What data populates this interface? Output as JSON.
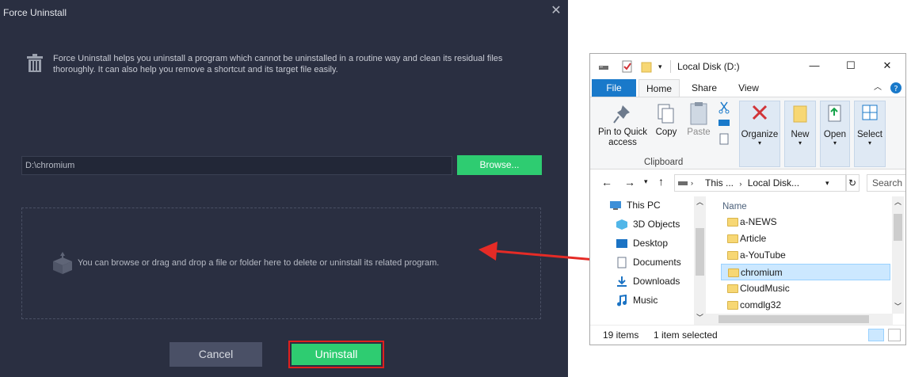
{
  "dialog": {
    "title": "Force Uninstall",
    "close_glyph": "✕",
    "description": "Force Uninstall helps you uninstall a program which cannot be uninstalled in a routine way and clean its residual files thoroughly. It can also help you remove a shortcut and its target file easily.",
    "path_value": "D:\\chromium",
    "browse_label": "Browse...",
    "drop_text": "You can browse or drag and drop a file or folder here to delete or uninstall its related program.",
    "cancel_label": "Cancel",
    "uninstall_label": "Uninstall",
    "colors": {
      "background": "#2a2f41",
      "accent_green": "#2ecc71",
      "highlight_red": "#e0201e"
    }
  },
  "explorer": {
    "title": "Local Disk (D:)",
    "tabs": [
      "File",
      "Home",
      "Share",
      "View"
    ],
    "ribbon": {
      "pin_label": "Pin to Quick access",
      "copy_label": "Copy",
      "paste_label": "Paste",
      "clipboard_label": "Clipboard",
      "organize_label": "Organize",
      "new_label": "New",
      "open_label": "Open",
      "select_label": "Select"
    },
    "address": {
      "this_pc": "This ...",
      "local_disk": "Local Disk...",
      "search_placeholder": "Search L"
    },
    "nav_items": [
      "This PC",
      "3D Objects",
      "Desktop",
      "Documents",
      "Downloads",
      "Music"
    ],
    "column_header": "Name",
    "files": [
      "a-NEWS",
      "Article",
      "a-YouTube",
      "chromium",
      "CloudMusic",
      "comdlg32"
    ],
    "selected_file": "chromium",
    "status": {
      "items": "19 items",
      "selected": "1 item selected"
    }
  }
}
